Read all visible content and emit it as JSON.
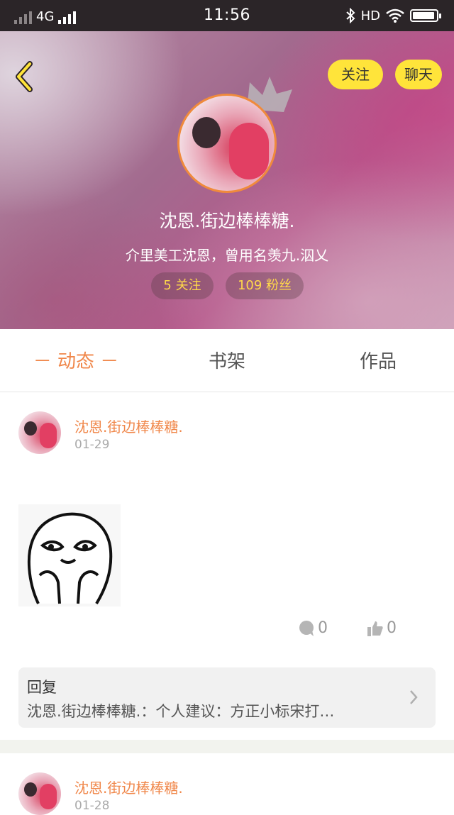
{
  "status_bar": {
    "network": "4G",
    "time": "11:56",
    "hd": "HD",
    "battery_level": 0.95
  },
  "profile": {
    "follow_button": "关注",
    "chat_button": "聊天",
    "nickname": "沈恩.街边棒棒糖.",
    "bio": "介里美工沈恩，曾用名羡九.泅乂",
    "following_chip": "5 关注",
    "fans_chip": "109 粉丝"
  },
  "tabs": [
    {
      "label": "－ 动态 －",
      "active": true
    },
    {
      "label": "书架",
      "active": false
    },
    {
      "label": "作品",
      "active": false
    }
  ],
  "feed": [
    {
      "author": "沈恩.街边棒棒糖.",
      "date": "01-29",
      "comments": "0",
      "likes": "0",
      "reply_label": "回复",
      "reply_text": "沈恩.街边棒棒糖.：个人建议：方正小标宋打…"
    },
    {
      "author": "沈恩.街边棒棒糖.",
      "date": "01-28"
    }
  ],
  "colors": {
    "accent_orange": "#f0874a",
    "button_yellow": "#ffe43a",
    "chip_text": "#ffd84a"
  }
}
